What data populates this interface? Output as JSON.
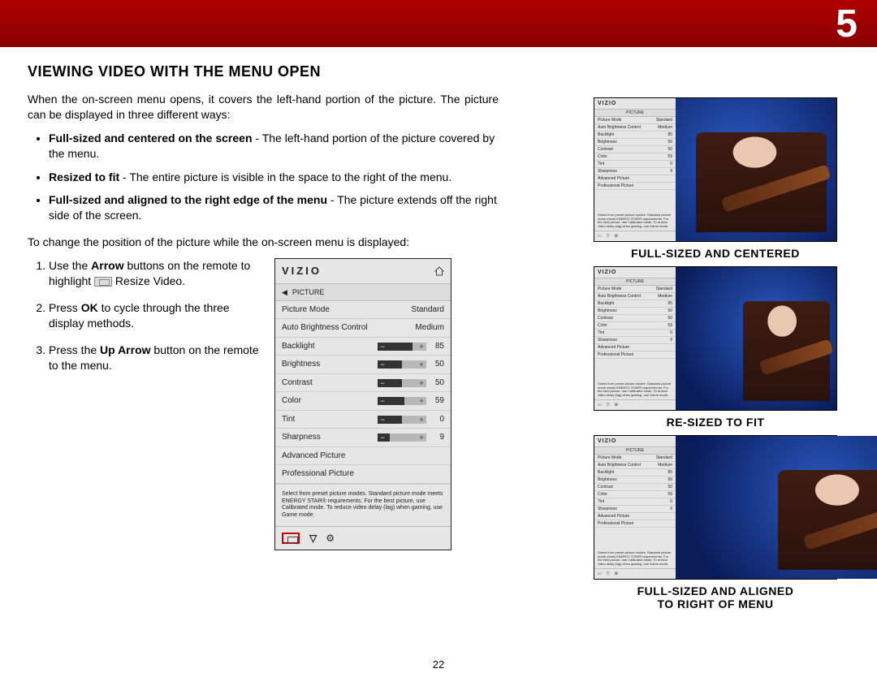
{
  "chapter_number": "5",
  "page_number": "22",
  "title": "VIEWING VIDEO WITH THE MENU OPEN",
  "intro": "When the on-screen menu opens, it covers the left-hand portion of the picture. The picture can be displayed in three different ways:",
  "bullets": [
    {
      "term": "Full-sized and centered on the screen",
      "desc": " - The left-hand portion of the picture covered by the menu."
    },
    {
      "term": "Resized to fit",
      "desc": " - The entire picture is visible in the space to the right of the menu."
    },
    {
      "term": "Full-sized and aligned to the right edge of the menu",
      "desc": " - The picture extends off the right side of the screen."
    }
  ],
  "instruction_lead": "To change the position of the picture while the on-screen menu is displayed:",
  "steps": {
    "s1a": "Use the ",
    "s1b": "Arrow",
    "s1c": " buttons on the remote to highlight ",
    "s1d": " Resize Video.",
    "s2a": "Press ",
    "s2b": "OK",
    "s2c": " to cycle through the three display methods.",
    "s3a": "Press the ",
    "s3b": "Up Arrow",
    "s3c": " button on the remote to the menu."
  },
  "osd": {
    "brand": "VIZIO",
    "category": "PICTURE",
    "items": [
      {
        "label": "Picture Mode",
        "value": "Standard",
        "type": "text"
      },
      {
        "label": "Auto Brightness Control",
        "value": "Medium",
        "type": "text"
      },
      {
        "label": "Backlight",
        "value": "85",
        "type": "slider",
        "pct": 85
      },
      {
        "label": "Brightness",
        "value": "50",
        "type": "slider",
        "pct": 50
      },
      {
        "label": "Contrast",
        "value": "50",
        "type": "slider",
        "pct": 50
      },
      {
        "label": "Color",
        "value": "59",
        "type": "slider",
        "pct": 59
      },
      {
        "label": "Tint",
        "value": "0",
        "type": "slider",
        "pct": 50
      },
      {
        "label": "Sharpness",
        "value": "9",
        "type": "slider",
        "pct": 9
      },
      {
        "label": "Advanced Picture",
        "type": "link"
      },
      {
        "label": "Professional Picture",
        "type": "link"
      }
    ],
    "footnote": "Select from preset picture modes. Standard picture mode meets ENERGY STAR® requirements. For the best picture, use Calibrated mode. To reduce video delay (lag) when gaming, use Game mode."
  },
  "thumbs": [
    {
      "mode": "centered",
      "caption": "FULL-SIZED AND CENTERED"
    },
    {
      "mode": "fit",
      "caption": "RE-SIZED TO FIT"
    },
    {
      "mode": "right",
      "caption1": "FULL-SIZED AND ALIGNED",
      "caption2": "TO RIGHT OF MENU"
    }
  ]
}
